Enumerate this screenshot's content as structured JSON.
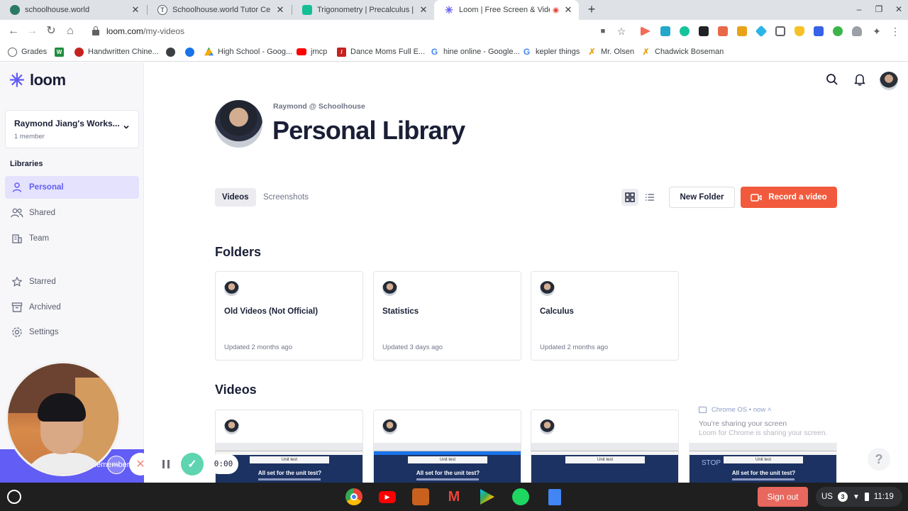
{
  "browser": {
    "tabs": [
      {
        "title": "schoolhouse.world",
        "icon": "schoolhouse-icon",
        "color": "#2a7a63"
      },
      {
        "title": "Schoolhouse.world Tutor Certific",
        "icon": "letter-t-icon",
        "color": "#5f6368"
      },
      {
        "title": "Trigonometry | Precalculus | Ma",
        "icon": "khan-academy-icon",
        "color": "#14bf96"
      },
      {
        "title": "Loom | Free Screen & Video",
        "icon": "loom-icon",
        "color": "#625df5"
      }
    ],
    "url_domain": "loom.com",
    "url_path": "/my-videos",
    "bookmarks": [
      {
        "label": "Grades",
        "icon": "grades-icon",
        "color": "#5f6368"
      },
      {
        "label": "",
        "icon": "w-icon",
        "color": "#1e8e3e"
      },
      {
        "label": "Handwritten Chine...",
        "icon": "handwritten-icon",
        "color": "#c5221f"
      },
      {
        "label": "",
        "icon": "globe-icon",
        "color": "#3c4043"
      },
      {
        "label": "",
        "icon": "settings-bm-icon",
        "color": "#1a73e8"
      },
      {
        "label": "High School - Goog...",
        "icon": "drive-icon",
        "color": "#f9ab00"
      },
      {
        "label": "jmcp",
        "icon": "youtube-icon",
        "color": "#ff0000"
      },
      {
        "label": "Dance Moms Full E...",
        "icon": "dance-moms-icon",
        "color": "#c5221f"
      },
      {
        "label": "hine online - Google...",
        "icon": "google-icon",
        "color": "#4285f4"
      },
      {
        "label": "kepler things",
        "icon": "google-icon",
        "color": "#4285f4"
      },
      {
        "label": "Mr. Olsen",
        "icon": "figure-icon",
        "color": "#e8a317"
      },
      {
        "label": "Chadwick Boseman",
        "icon": "figure-icon",
        "color": "#e8a317"
      }
    ]
  },
  "sidebar": {
    "logo_text": "loom",
    "workspace": {
      "name": "Raymond Jiang's Works...",
      "members": "1 member"
    },
    "libraries_header": "Libraries",
    "items": [
      {
        "label": "Personal",
        "icon": "person-icon"
      },
      {
        "label": "Shared",
        "icon": "people-icon"
      },
      {
        "label": "Team",
        "icon": "building-icon"
      },
      {
        "label": "Starred",
        "icon": "star-icon"
      },
      {
        "label": "Archived",
        "icon": "archive-icon"
      },
      {
        "label": "Settings",
        "icon": "gear-icon"
      }
    ]
  },
  "main": {
    "owner": "Raymond @ Schoolhouse",
    "title": "Personal Library",
    "tabs": [
      {
        "label": "Videos"
      },
      {
        "label": "Screenshots"
      }
    ],
    "new_folder_label": "New Folder",
    "record_label": "Record a video",
    "folders_header": "Folders",
    "folders": [
      {
        "name": "Old Videos (Not Official)",
        "updated": "Updated 2 months ago"
      },
      {
        "name": "Statistics",
        "updated": "Updated 3 days ago"
      },
      {
        "name": "Calculus",
        "updated": "Updated 2 months ago"
      }
    ],
    "videos_header": "Videos",
    "videos": [
      {
        "thumb_bar": "Unit test",
        "thumb_text": "All set for the unit test?"
      },
      {
        "thumb_bar": "Unit test",
        "thumb_text": "All set for the unit test?"
      },
      {
        "thumb_bar": "Unit test",
        "thumb_text": ""
      },
      {
        "thumb_bar": "Unit test",
        "thumb_text": "All set for the unit test?"
      }
    ]
  },
  "notification": {
    "source": "Chrome OS",
    "time": "now",
    "title": "You're sharing your screen",
    "body": "Loom for Chrome is sharing your screen.",
    "stop_label": "STOP"
  },
  "help_label": "?",
  "recorder": {
    "hint": "Remember",
    "timer": "0:00"
  },
  "shelf": {
    "sign_out": "Sign out",
    "locale": "US",
    "notifications_count": "3",
    "clock": "11:19"
  },
  "colors": {
    "brand": "#625df5",
    "record": "#f15a3c",
    "sign_out": "#e8675e"
  }
}
